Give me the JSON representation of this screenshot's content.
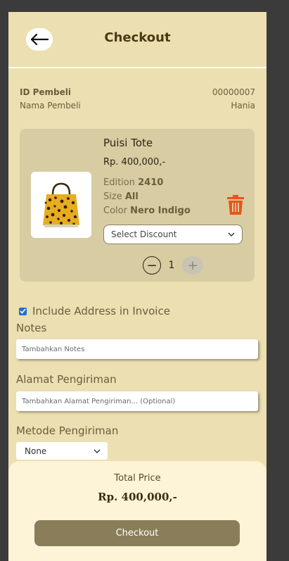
{
  "header": {
    "title": "Checkout",
    "back_icon": "arrow-left-icon"
  },
  "buyer": {
    "id_label": "ID Pembeli",
    "id_value": "00000007",
    "name_label": "Nama Pembeli",
    "name_value": "Hania"
  },
  "product": {
    "name": "Puisi Tote",
    "price": "Rp. 400,000,-",
    "edition_label": "Edition",
    "edition_value": "2410",
    "size_label": "Size",
    "size_value": "All",
    "color_label": "Color",
    "color_value": "Nero Indigo",
    "discount_select": "Select Discount",
    "quantity": "1",
    "image_icon": "tote-bag-image",
    "delete_icon": "trash-icon",
    "delete_color": "#e8531c"
  },
  "options": {
    "include_address_label": "Include Address in Invoice",
    "include_address_checked": true,
    "notes_label": "Notes",
    "notes_placeholder": "Tambahkan Notes",
    "alamat_label": "Alamat Pengiriman",
    "alamat_placeholder": "Tambahkan Alamat Pengiriman... (Optional)",
    "metode_label": "Metode Pengiriman",
    "metode_value": "None"
  },
  "summary": {
    "total_label": "Total Price",
    "total_value": "Rp.  400,000,-",
    "checkout_label": "Checkout"
  },
  "colors": {
    "background": "#ecdfb2",
    "card": "#d8cca2",
    "button": "#8a7e5a",
    "footer": "#fdf3d6"
  }
}
